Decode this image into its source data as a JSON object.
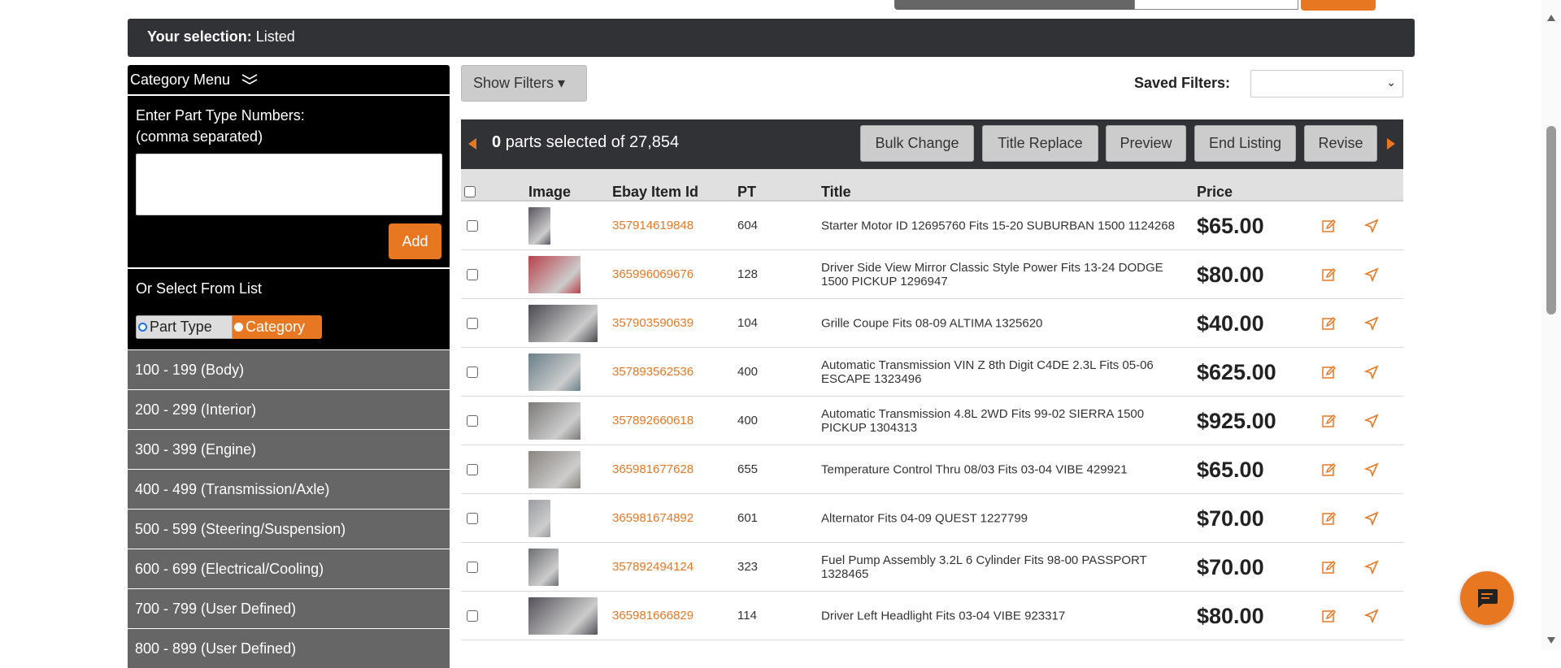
{
  "selection": {
    "label": "Your selection:",
    "value": "Listed"
  },
  "sidebar": {
    "menu_title": "Category Menu",
    "entry_label": "Enter Part Type Numbers:",
    "entry_hint": "(comma separated)",
    "entry_value": "",
    "add_label": "Add",
    "or_select": "Or Select From List",
    "toggle": {
      "part_type": "Part Type",
      "category": "Category",
      "selected": "category"
    },
    "items": [
      "100 - 199 (Body)",
      "200 - 299 (Interior)",
      "300 - 399 (Engine)",
      "400 - 499 (Transmission/Axle)",
      "500 - 599 (Steering/Suspension)",
      "600 - 699 (Electrical/Cooling)",
      "700 - 799 (User Defined)",
      "800 - 899 (User Defined)"
    ]
  },
  "filters": {
    "show_label": "Show Filters ▾",
    "saved_label": "Saved Filters:",
    "saved_value": ""
  },
  "toolbar": {
    "count": "0",
    "count_text": "parts selected of 27,854",
    "buttons": [
      "Bulk Change",
      "Title Replace",
      "Preview",
      "End Listing",
      "Revise"
    ]
  },
  "table": {
    "headers": {
      "image": "Image",
      "id": "Ebay Item Id",
      "pt": "PT",
      "title": "Title",
      "price": "Price"
    },
    "rows": [
      {
        "id": "357914619848",
        "pt": "604",
        "title": "Starter Motor ID 12695760 Fits 15-20 SUBURBAN 1500 1124268",
        "price": "$65.00",
        "img": "#5a5560"
      },
      {
        "id": "365996069676",
        "pt": "128",
        "title": "Driver Side View Mirror Classic Style Power Fits 13-24 DODGE 1500 PICKUP 1296947",
        "price": "$80.00",
        "img": "#b8424a"
      },
      {
        "id": "357903590639",
        "pt": "104",
        "title": "Grille Coupe Fits 08-09 ALTIMA 1325620",
        "price": "$40.00",
        "img": "#4a4a50"
      },
      {
        "id": "357893562536",
        "pt": "400",
        "title": "Automatic Transmission VIN Z 8th Digit C4DE 2.3L Fits 05-06 ESCAPE 1323496",
        "price": "$625.00",
        "img": "#6a7f8a"
      },
      {
        "id": "357892660618",
        "pt": "400",
        "title": "Automatic Transmission 4.8L 2WD Fits 99-02 SIERRA 1500 PICKUP 1304313",
        "price": "$925.00",
        "img": "#7b7a78"
      },
      {
        "id": "365981677628",
        "pt": "655",
        "title": "Temperature Control Thru 08/03 Fits 03-04 VIBE 429921",
        "price": "$65.00",
        "img": "#8a8580"
      },
      {
        "id": "365981674892",
        "pt": "601",
        "title": "Alternator Fits 04-09 QUEST 1227799",
        "price": "$70.00",
        "img": "#9a9ca0"
      },
      {
        "id": "357892494124",
        "pt": "323",
        "title": "Fuel Pump Assembly 3.2L 6 Cylinder Fits 98-00 PASSPORT 1328465",
        "price": "$70.00",
        "img": "#6d6f72"
      },
      {
        "id": "365981666829",
        "pt": "114",
        "title": "Driver Left Headlight Fits 03-04 VIBE 923317",
        "price": "$80.00",
        "img": "#55525a"
      }
    ]
  },
  "colors": {
    "accent": "#e87722",
    "dark": "#303236"
  }
}
